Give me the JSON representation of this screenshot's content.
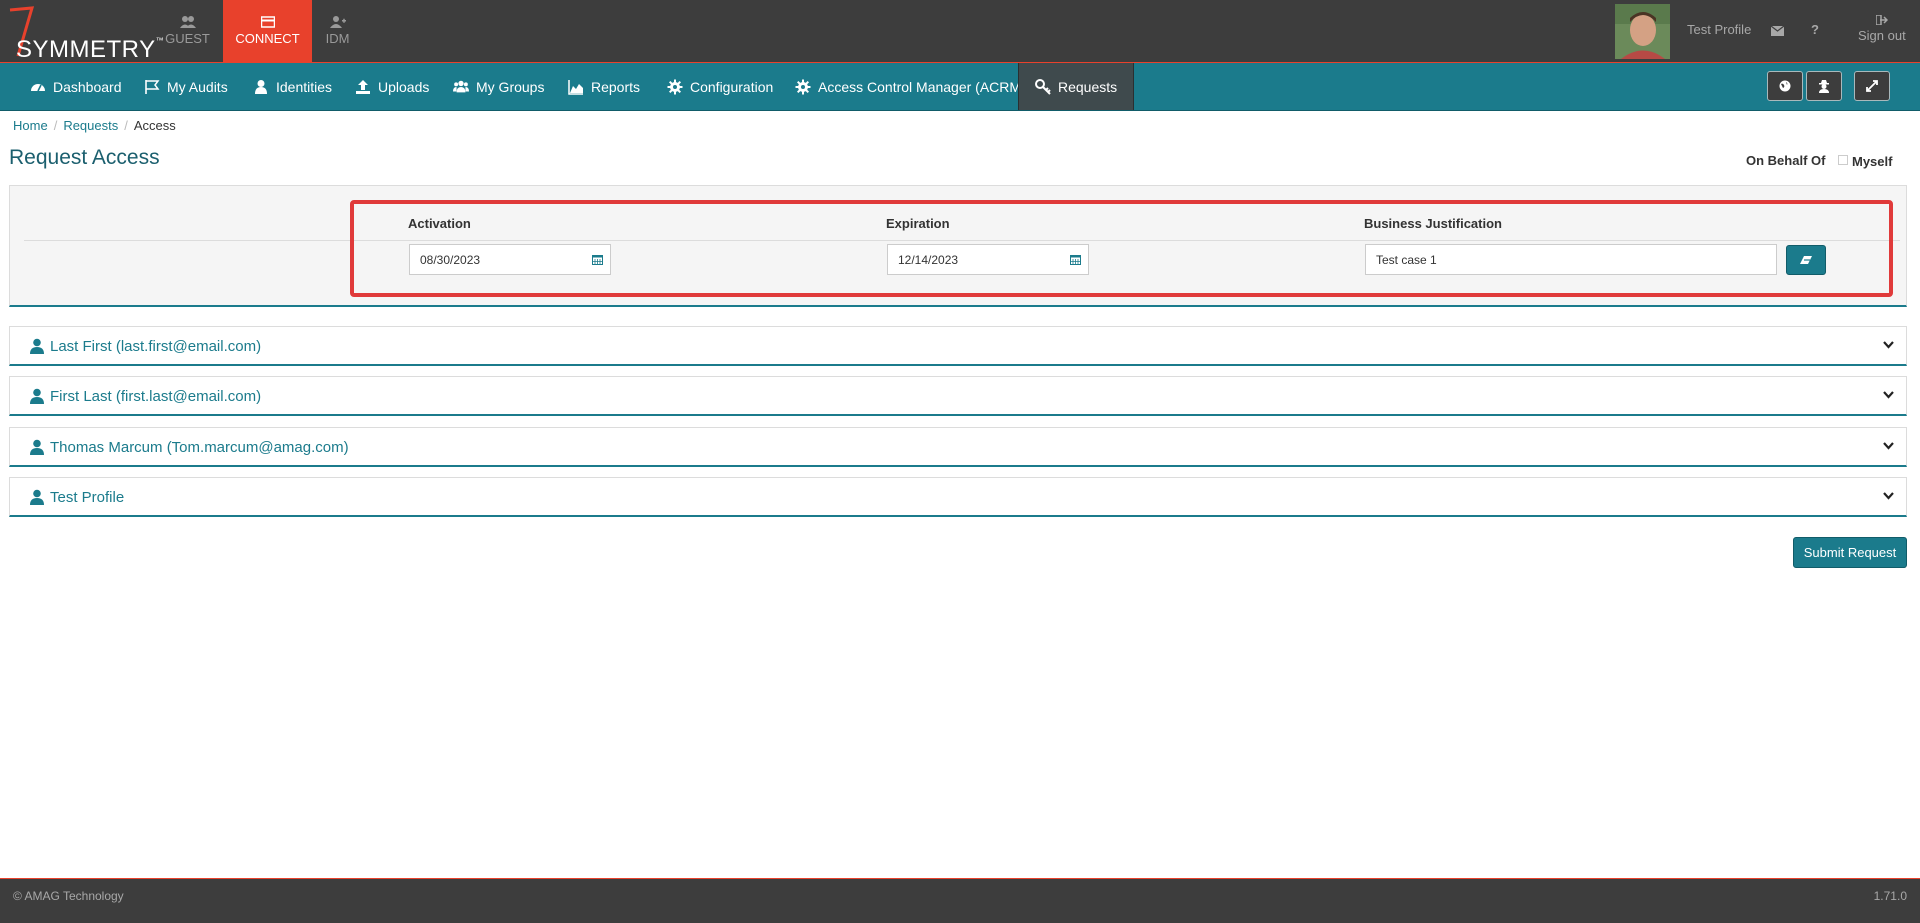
{
  "brand": {
    "name": "SYMMETRY",
    "tm": "™"
  },
  "modules": [
    {
      "label": "GUEST",
      "icon": "users-icon"
    },
    {
      "label": "CONNECT",
      "icon": "card-icon"
    },
    {
      "label": "IDM",
      "icon": "user-plus-icon"
    }
  ],
  "user": {
    "name": "Test Profile",
    "sign_out": "Sign out",
    "help": "?"
  },
  "nav": [
    {
      "label": "Dashboard",
      "icon": "dashboard-icon"
    },
    {
      "label": "My Audits",
      "icon": "flag-icon"
    },
    {
      "label": "Identities",
      "icon": "user-icon"
    },
    {
      "label": "Uploads",
      "icon": "upload-icon"
    },
    {
      "label": "My Groups",
      "icon": "group-icon"
    },
    {
      "label": "Reports",
      "icon": "area-chart-icon"
    },
    {
      "label": "Configuration",
      "icon": "gear-icon"
    },
    {
      "label": "Access Control Manager (ACRM)",
      "icon": "gear-icon"
    },
    {
      "label": "Requests",
      "icon": "key-icon"
    }
  ],
  "breadcrumb": {
    "home": "Home",
    "requests": "Requests",
    "current": "Access"
  },
  "page": {
    "title": "Request Access",
    "on_behalf_of": "On Behalf Of",
    "myself": "Myself"
  },
  "form": {
    "activation_label": "Activation",
    "activation_value": "08/30/2023",
    "expiration_label": "Expiration",
    "expiration_value": "12/14/2023",
    "justification_label": "Business Justification",
    "justification_value": "Test case 1"
  },
  "people": [
    {
      "label": "Last First (last.first@email.com)"
    },
    {
      "label": "First Last (first.last@email.com)"
    },
    {
      "label": "Thomas Marcum (Tom.marcum@amag.com)"
    },
    {
      "label": "Test Profile"
    }
  ],
  "submit_label": "Submit Request",
  "footer": {
    "copyright": "© AMAG Technology",
    "version": "1.71.0"
  },
  "colors": {
    "accent": "#1b7b8c",
    "brand": "#e8412c",
    "dark": "#3d3d3d",
    "highlight": "#e03a3a"
  }
}
